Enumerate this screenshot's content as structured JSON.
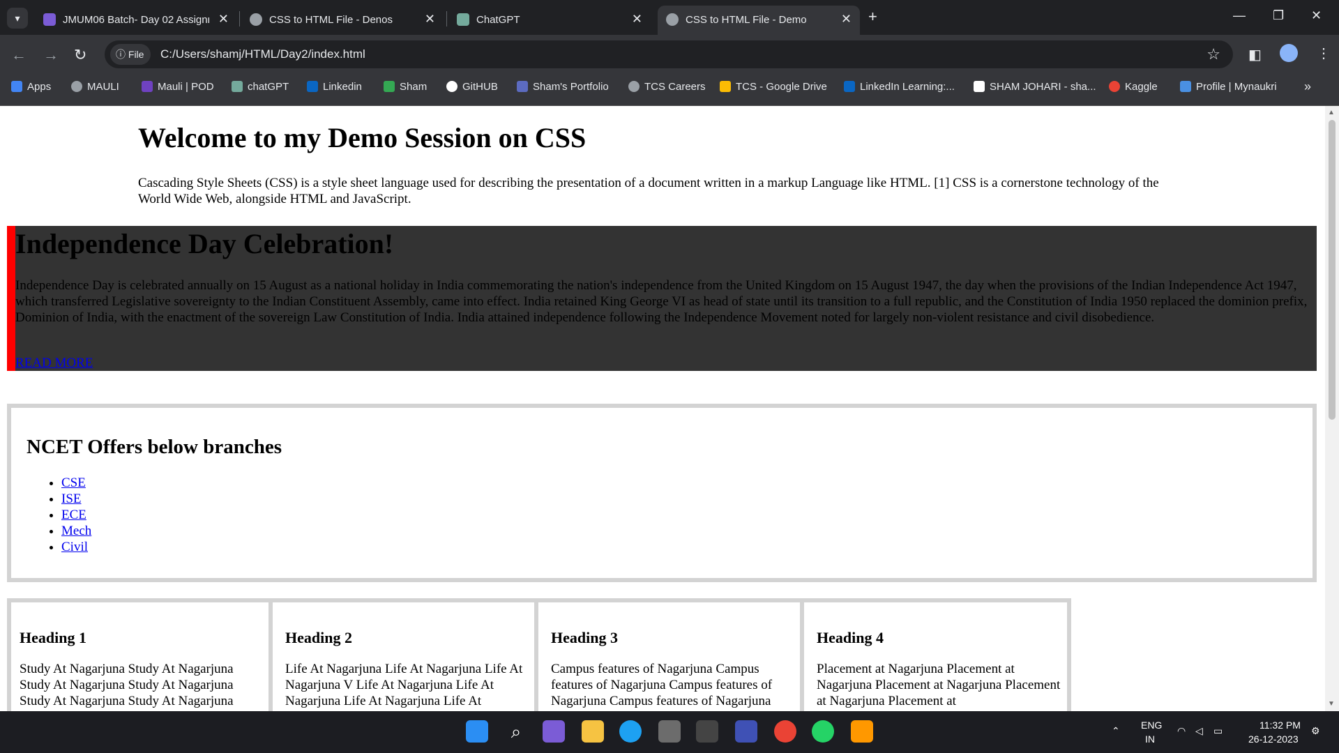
{
  "tabs": [
    {
      "title": "JMUM06 Batch- Day 02 Assignm",
      "favicon": "form-icon",
      "color": "#7b5cd6"
    },
    {
      "title": "CSS to HTML File - Denos",
      "favicon": "globe-icon",
      "color": "#9aa0a6"
    },
    {
      "title": "ChatGPT",
      "favicon": "chatgpt-icon",
      "color": "#74aa9c"
    },
    {
      "title": "CSS to HTML File - Demo",
      "favicon": "globe-icon",
      "color": "#9aa0a6"
    }
  ],
  "address": {
    "chip": "File",
    "url": "C:/Users/shamj/HTML/Day2/index.html"
  },
  "bookmarks": [
    {
      "label": "Apps",
      "color": "#4285f4"
    },
    {
      "label": "MAULI",
      "color": "#9aa0a6"
    },
    {
      "label": "Mauli | POD",
      "color": "#6f42c1"
    },
    {
      "label": "chatGPT",
      "color": "#74aa9c"
    },
    {
      "label": "Linkedin",
      "color": "#0a66c2"
    },
    {
      "label": "Sham",
      "color": "#34a853"
    },
    {
      "label": "GitHUB",
      "color": "#ffffff"
    },
    {
      "label": "Sham's Portfolio",
      "color": "#5c6bc0"
    },
    {
      "label": "TCS Careers",
      "color": "#9aa0a6"
    },
    {
      "label": "TCS - Google Drive",
      "color": "#fbbc04"
    },
    {
      "label": "LinkedIn Learning:...",
      "color": "#0a66c2"
    },
    {
      "label": "SHAM JOHARI - sha...",
      "color": "#ffffff"
    },
    {
      "label": "Kaggle",
      "color": "#ea4335"
    },
    {
      "label": "Profile | Mynaukri",
      "color": "#4a90e2"
    }
  ],
  "page": {
    "intro_title": "Welcome to my Demo Session on CSS",
    "intro_text": "Cascading Style Sheets (CSS) is a style sheet language used for describing the presentation of a document written in a markup Language like HTML. [1] CSS is a cornerstone technology of the World Wide Web, alongside HTML and JavaScript.",
    "indep_title": "Independence Day Celebration!",
    "indep_text": "Independence Day is celebrated annually on 15 August as a national holiday in India commemorating the nation's independence from the United Kingdom on 15 August 1947, the day when the provisions of the Indian Independence Act 1947, which transferred Legislative sovereignty to the Indian Constituent Assembly, came into effect. India retained King George VI as head of state until its transition to a full republic, and the Constitution of India 1950 replaced the dominion prefix, Dominion of India, with the enactment of the sovereign Law Constitution of India. India attained independence following the Independence Movement noted for largely non-violent resistance and civil disobedience.",
    "read_more": "READ MORE",
    "ncet_title": "NCET Offers below branches",
    "branches": [
      "CSE",
      "ISE",
      "ECE",
      "Mech",
      "Civil"
    ],
    "cards": [
      {
        "heading": "Heading 1",
        "text": "Study At Nagarjuna Study At Nagarjuna Study At Nagarjuna Study At Nagarjuna Study At Nagarjuna Study At Nagarjuna"
      },
      {
        "heading": "Heading 2",
        "text": "Life At Nagarjuna Life At Nagarjuna Life At Nagarjuna V Life At Nagarjuna Life At Nagarjuna Life At Nagarjuna Life At"
      },
      {
        "heading": "Heading 3",
        "text": "Campus features of Nagarjuna Campus features of Nagarjuna Campus features of Nagarjuna Campus features of Nagarjuna"
      },
      {
        "heading": "Heading 4",
        "text": "Placement at Nagarjuna Placement at Nagarjuna Placement at Nagarjuna Placement at Nagarjuna Placement at"
      }
    ]
  },
  "taskbar": {
    "apps": [
      "start-icon",
      "search-icon",
      "copilot-icon",
      "file-explorer-icon",
      "edge-icon",
      "store-icon",
      "app-icon",
      "vscode-icon",
      "chrome-icon",
      "whatsapp-icon",
      "sublime-icon"
    ],
    "lang": "ENG",
    "region": "IN",
    "time": "11:32 PM",
    "date": "26-12-2023"
  }
}
